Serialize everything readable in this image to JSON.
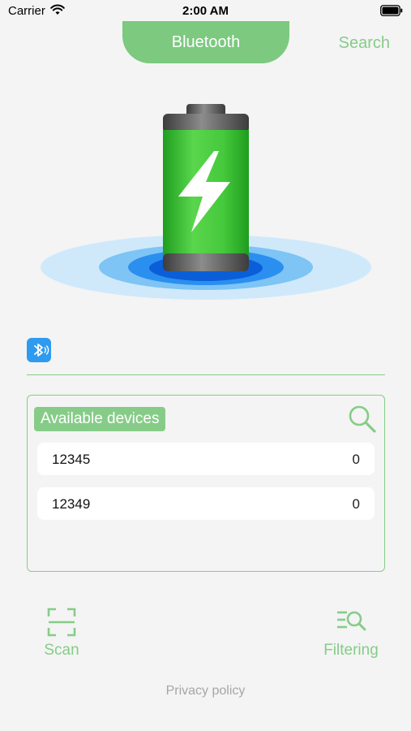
{
  "status_bar": {
    "carrier": "Carrier",
    "time": "2:00 AM"
  },
  "nav": {
    "title": "Bluetooth",
    "search_label": "Search"
  },
  "hero": {
    "icon": "battery-charging-icon",
    "colors": {
      "battery": "#3cc43a",
      "ripple": "#2196f3"
    }
  },
  "bluetooth_badge": {
    "icon": "bluetooth-icon",
    "color": "#2e9bf0"
  },
  "devices_panel": {
    "title": "Available devices",
    "search_icon": "search-icon",
    "devices": [
      {
        "name": "12345",
        "value": "0"
      },
      {
        "name": "12349",
        "value": "0"
      }
    ]
  },
  "actions": {
    "scan_label": "Scan",
    "filter_label": "Filtering",
    "privacy_label": "Privacy policy"
  },
  "theme": {
    "accent": "#86cc88",
    "tab_bg": "#7cc97f",
    "background": "#f4f4f4"
  }
}
